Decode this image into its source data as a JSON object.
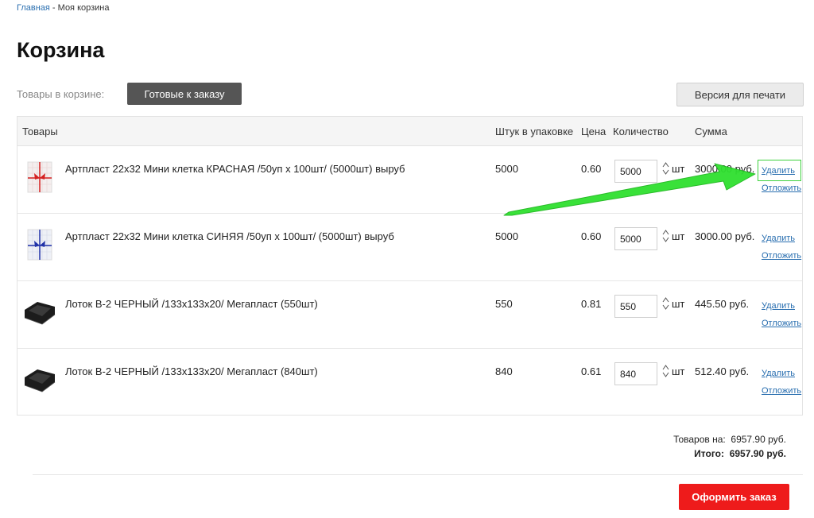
{
  "breadcrumb": {
    "home": "Главная",
    "separator": " - ",
    "current": "Моя корзина"
  },
  "page_title": "Корзина",
  "tabs": {
    "label": "Товары в корзине:",
    "ready": "Готовые к заказу"
  },
  "print_button": "Версия для печати",
  "table": {
    "headers": {
      "goods": "Товары",
      "pack": "Штук в упаковке",
      "price": "Цена",
      "qty": "Количество",
      "sum": "Сумма"
    },
    "rows": [
      {
        "name": "Артпласт 22х32 Мини клетка КРАСНАЯ /50уп х 100шт/ (5000шт) выруб",
        "pack": "5000",
        "price": "0.60",
        "qty": "5000",
        "unit": "шт",
        "sum": "3000.00 руб.",
        "delete": "Удалить",
        "postpone": "Отложить",
        "thumb": "bag-red-bow"
      },
      {
        "name": "Артпласт 22х32 Мини клетка СИНЯЯ /50уп х 100шт/ (5000шт) выруб",
        "pack": "5000",
        "price": "0.60",
        "qty": "5000",
        "unit": "шт",
        "sum": "3000.00 руб.",
        "delete": "Удалить",
        "postpone": "Отложить",
        "thumb": "bag-blue-bow"
      },
      {
        "name": "Лоток В-2 ЧЕРНЫЙ /133х133х20/ Мегапласт (550шт)",
        "pack": "550",
        "price": "0.81",
        "qty": "550",
        "unit": "шт",
        "sum": "445.50 руб.",
        "delete": "Удалить",
        "postpone": "Отложить",
        "thumb": "black-tray"
      },
      {
        "name": "Лоток В-2 ЧЕРНЫЙ /133х133х20/ Мегапласт (840шт)",
        "pack": "840",
        "price": "0.61",
        "qty": "840",
        "unit": "шт",
        "sum": "512.40 руб.",
        "delete": "Удалить",
        "postpone": "Отложить",
        "thumb": "black-tray"
      }
    ]
  },
  "totals": {
    "goods_label": "Товаров на:",
    "goods_value": "6957.90 руб.",
    "total_label": "Итого:",
    "total_value": "6957.90 руб."
  },
  "checkout_button": "Оформить заказ",
  "colors": {
    "link": "#2a6fb0",
    "checkout": "#ee1b1b",
    "tab_active": "#555555",
    "annotation": "#3ed13e"
  }
}
